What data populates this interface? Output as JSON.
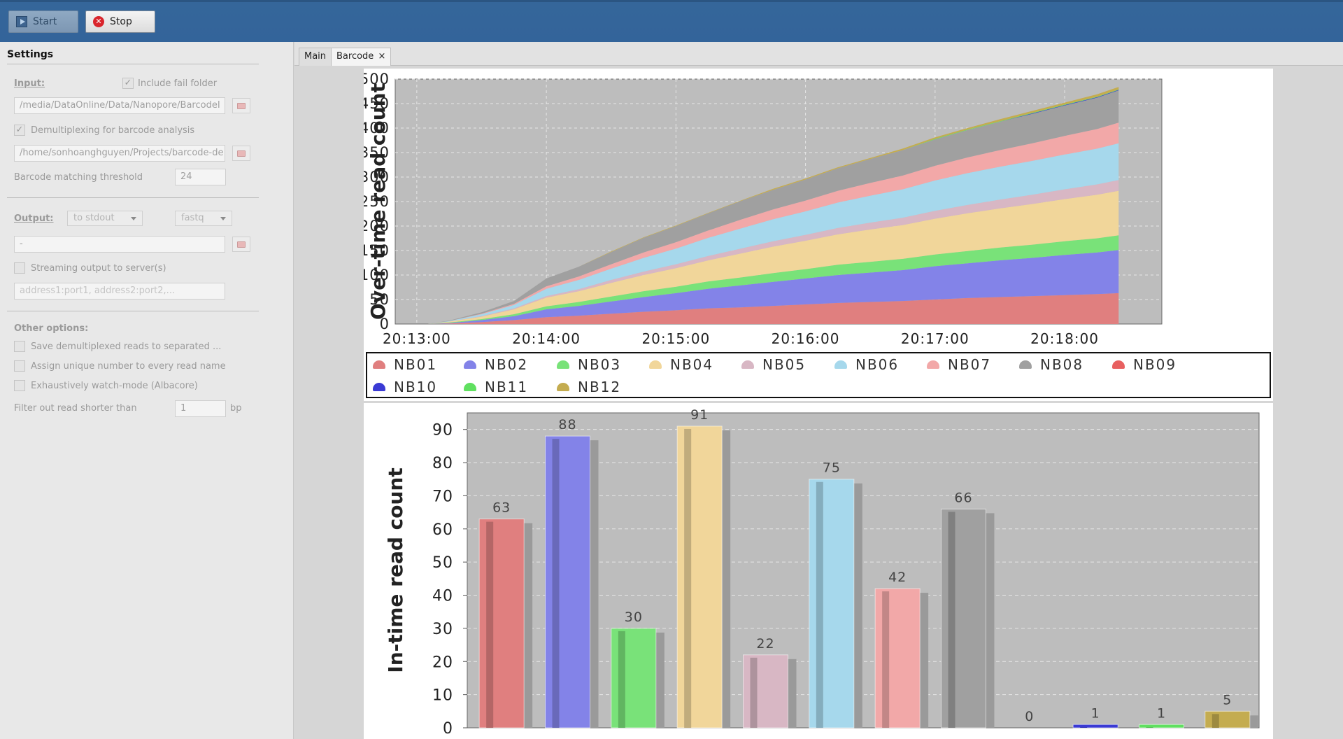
{
  "toolbar": {
    "start_label": "Start",
    "stop_label": "Stop"
  },
  "sidebar": {
    "title": "Settings",
    "input_label": "Input:",
    "include_fail_label": "Include fail folder",
    "input_path": "/media/DataOnline/Data/Nanopore/BarcodeI",
    "demux_label": "Demultiplexing for barcode analysis",
    "barcode_path": "/home/sonhoanghguyen/Projects/barcode-de",
    "threshold_label": "Barcode matching threshold",
    "threshold_value": "24",
    "output_label": "Output:",
    "output_target": "to stdout",
    "output_format": "fastq",
    "output_path": "-",
    "streaming_label": "Streaming output to server(s)",
    "streaming_placeholder": "address1:port1, address2:port2,...",
    "other_label": "Other options:",
    "opt_save": "Save demultiplexed reads to separated ...",
    "opt_assign": "Assign unique number to every read name",
    "opt_watch": "Exhaustively watch-mode (Albacore)",
    "filter_label": "Filter out read shorter than",
    "filter_value": "1",
    "filter_unit": "bp"
  },
  "tabs": {
    "main": "Main",
    "barcode": "Barcode",
    "close": "×"
  },
  "colors": {
    "plot_bg": "#bdbdbd",
    "NB01": "#e07f7f",
    "NB02": "#8383e8",
    "NB03": "#79e279",
    "NB04": "#f1d69a",
    "NB05": "#d8b7c4",
    "NB06": "#a6d8ec",
    "NB07": "#f2a8a8",
    "NB08": "#a0a0a0",
    "NB09": "#e86060",
    "NB10": "#3a3ad4",
    "NB11": "#60e060",
    "NB12": "#c4ac50"
  },
  "chart_data": [
    {
      "type": "area",
      "stacked": true,
      "ylabel": "Over-time read count",
      "ylim": [
        0,
        500
      ],
      "y_ticks": [
        "0",
        "50",
        "100",
        "150",
        "200",
        "250",
        "300",
        "350",
        "400",
        "450",
        "500"
      ],
      "x_ticks": [
        "20:13:00",
        "20:14:00",
        "20:15:00",
        "20:16:00",
        "20:17:00",
        "20:18:00"
      ],
      "x": [
        "20:13:05",
        "20:13:15",
        "20:13:30",
        "20:13:45",
        "20:14:00",
        "20:14:15",
        "20:14:30",
        "20:14:45",
        "20:15:00",
        "20:15:15",
        "20:15:30",
        "20:15:45",
        "20:16:00",
        "20:16:15",
        "20:16:30",
        "20:16:45",
        "20:17:00",
        "20:17:15",
        "20:17:30",
        "20:17:45",
        "20:18:00",
        "20:18:15",
        "20:18:25"
      ],
      "legend_position": "bottom",
      "series": [
        {
          "name": "NB01",
          "values": [
            0,
            1,
            4,
            8,
            14,
            17,
            21,
            25,
            28,
            32,
            34,
            37,
            40,
            43,
            45,
            47,
            50,
            53,
            55,
            57,
            59,
            61,
            63
          ]
        },
        {
          "name": "NB02",
          "values": [
            0,
            1,
            4,
            8,
            16,
            20,
            25,
            30,
            35,
            40,
            45,
            49,
            53,
            57,
            60,
            63,
            68,
            71,
            75,
            78,
            82,
            85,
            88
          ]
        },
        {
          "name": "NB03",
          "values": [
            0,
            1,
            2,
            4,
            6,
            8,
            10,
            12,
            13,
            15,
            16,
            18,
            19,
            21,
            22,
            23,
            24,
            25,
            26,
            27,
            28,
            29,
            30
          ]
        },
        {
          "name": "NB04",
          "values": [
            0,
            2,
            5,
            10,
            18,
            22,
            28,
            33,
            38,
            43,
            49,
            54,
            58,
            62,
            66,
            69,
            73,
            77,
            80,
            83,
            86,
            89,
            91
          ]
        },
        {
          "name": "NB05",
          "values": [
            0,
            0,
            1,
            2,
            3,
            4,
            6,
            7,
            8,
            9,
            10,
            11,
            12,
            13,
            14,
            15,
            16,
            17,
            18,
            19,
            20,
            21,
            22
          ]
        },
        {
          "name": "NB06",
          "values": [
            0,
            1,
            4,
            7,
            15,
            19,
            23,
            28,
            32,
            37,
            41,
            45,
            48,
            52,
            55,
            58,
            62,
            65,
            67,
            69,
            71,
            73,
            75
          ]
        },
        {
          "name": "NB07",
          "values": [
            0,
            0,
            1,
            2,
            5,
            7,
            9,
            11,
            13,
            15,
            18,
            20,
            22,
            24,
            26,
            28,
            30,
            32,
            34,
            36,
            38,
            40,
            42
          ]
        },
        {
          "name": "NB08",
          "values": [
            0,
            1,
            3,
            6,
            16,
            20,
            25,
            30,
            33,
            35,
            38,
            40,
            43,
            46,
            49,
            52,
            54,
            56,
            58,
            60,
            62,
            64,
            66
          ]
        },
        {
          "name": "NB09",
          "values": [
            0,
            0,
            0,
            0,
            0,
            0,
            0,
            0,
            0,
            0,
            0,
            0,
            0,
            0,
            0,
            0,
            0,
            0,
            0,
            0,
            0,
            0,
            0
          ]
        },
        {
          "name": "NB10",
          "values": [
            0,
            0,
            0,
            0,
            0,
            0,
            0,
            0,
            0,
            0,
            0,
            0,
            0,
            0,
            0,
            0,
            0,
            0,
            0,
            1,
            1,
            1,
            1
          ]
        },
        {
          "name": "NB11",
          "values": [
            0,
            0,
            0,
            0,
            0,
            0,
            0,
            0,
            0,
            0,
            0,
            0,
            0,
            0,
            0,
            0,
            1,
            1,
            1,
            1,
            1,
            1,
            1
          ]
        },
        {
          "name": "NB12",
          "values": [
            0,
            0,
            0,
            0,
            0,
            0,
            1,
            1,
            1,
            1,
            1,
            2,
            2,
            2,
            2,
            3,
            3,
            3,
            4,
            4,
            4,
            5,
            5
          ]
        }
      ]
    },
    {
      "type": "bar",
      "ylabel": "In-time read count",
      "ylim": [
        0,
        95
      ],
      "y_ticks": [
        "0",
        "10",
        "20",
        "30",
        "40",
        "50",
        "60",
        "70",
        "80",
        "90"
      ],
      "categories": [
        "NB01",
        "NB02",
        "NB03",
        "NB04",
        "NB05",
        "NB06",
        "NB07",
        "NB08",
        "NB09",
        "NB10",
        "NB11",
        "NB12"
      ],
      "values": [
        63,
        88,
        30,
        91,
        22,
        75,
        42,
        66,
        0,
        1,
        1,
        5
      ],
      "value_labels": [
        "63",
        "88",
        "30",
        "91",
        "22",
        "75",
        "42",
        "66",
        "0",
        "1",
        "1",
        "5"
      ]
    }
  ]
}
